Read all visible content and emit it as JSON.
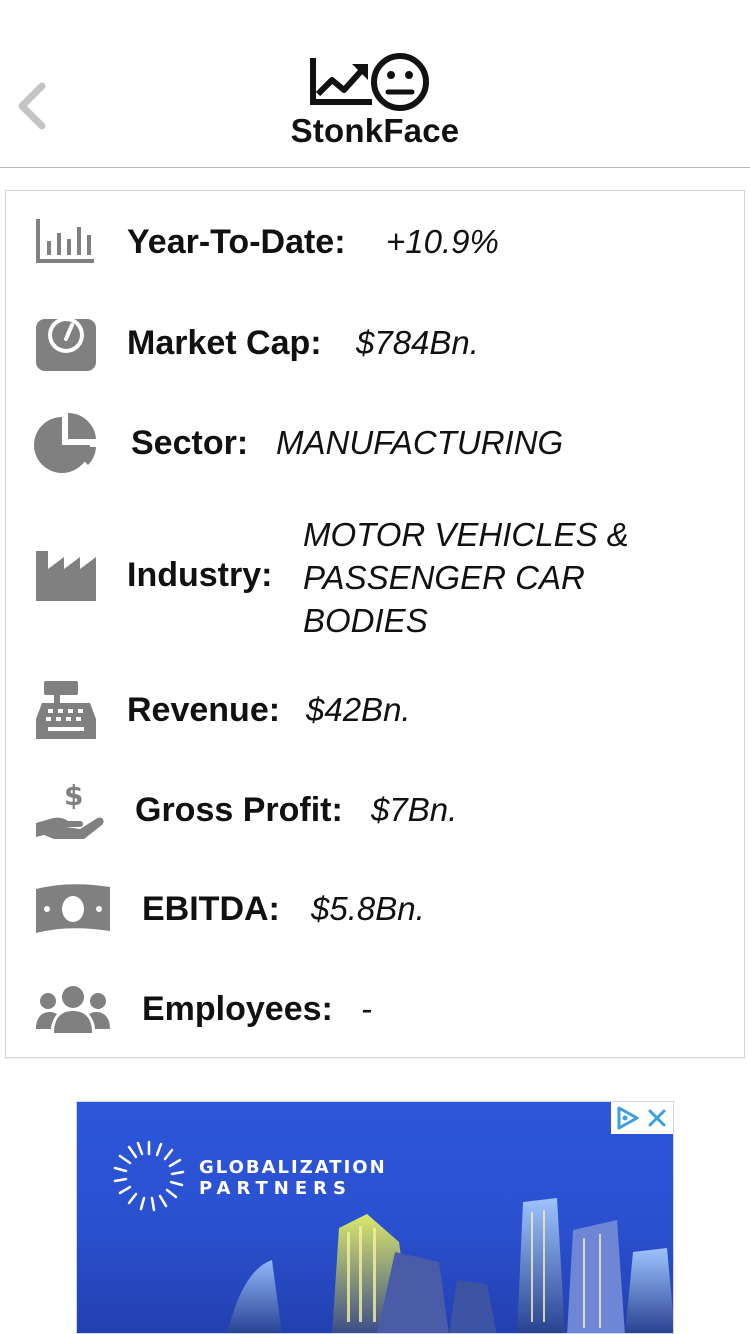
{
  "app": {
    "title": "StonkFace"
  },
  "nav": {
    "back_icon": "chevron-left-icon",
    "logo_icons": [
      "chart-line-icon",
      "neutral-face-icon"
    ]
  },
  "stats": [
    {
      "icon": "bar-chart-icon",
      "label": "Year-To-Date:",
      "value": "+10.9%"
    },
    {
      "icon": "gauge-icon",
      "label": "Market Cap:",
      "value": "$784Bn."
    },
    {
      "icon": "pie-chart-icon",
      "label": "Sector:",
      "value": "MANUFACTURING"
    },
    {
      "icon": "factory-icon",
      "label": "Industry:",
      "value": "MOTOR VEHICLES & PASSENGER CAR BODIES"
    },
    {
      "icon": "cash-register-icon",
      "label": "Revenue:",
      "value": "$42Bn."
    },
    {
      "icon": "hand-dollar-icon",
      "label": "Gross Profit:",
      "value": "$7Bn."
    },
    {
      "icon": "money-bill-icon",
      "label": "EBITDA:",
      "value": "$5.8Bn."
    },
    {
      "icon": "users-icon",
      "label": "Employees:",
      "value": "-"
    }
  ],
  "ad": {
    "brand_line1": "GLOBALIZATION",
    "brand_line2": "PARTNERS",
    "icons": [
      "adchoices-icon",
      "close-icon"
    ]
  },
  "colors": {
    "icon_gray": "#808080",
    "ad_blue": "#2d56d9",
    "adchoices_blue": "#3aa0e0"
  }
}
